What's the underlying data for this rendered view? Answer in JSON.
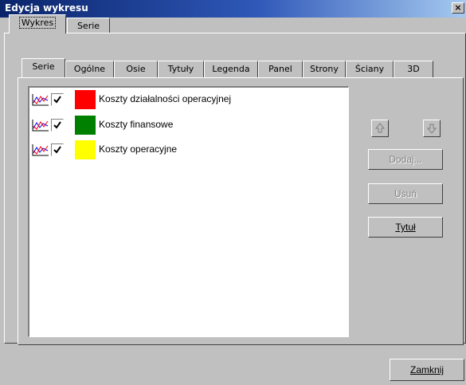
{
  "window": {
    "title": "Edycja wykresu",
    "close_glyph": "×"
  },
  "outer_tabs": [
    {
      "label": "Wykres",
      "active": true
    },
    {
      "label": "Serie",
      "active": false
    }
  ],
  "inner_tabs": [
    {
      "label": "Serie",
      "active": true
    },
    {
      "label": "Ogólne"
    },
    {
      "label": "Osie"
    },
    {
      "label": "Tytuły"
    },
    {
      "label": "Legenda"
    },
    {
      "label": "Panel"
    },
    {
      "label": "Strony"
    },
    {
      "label": "Ściany"
    },
    {
      "label": "3D"
    }
  ],
  "series": [
    {
      "name": "Koszty działalności operacyjnej",
      "color": "#ff0000",
      "checked": true,
      "icon": "line-chart-icon"
    },
    {
      "name": "Koszty finansowe",
      "color": "#008000",
      "checked": true,
      "icon": "line-chart-icon"
    },
    {
      "name": "Koszty operacyjne",
      "color": "#ffff00",
      "checked": true,
      "icon": "line-chart-icon"
    }
  ],
  "buttons": {
    "move_up_icon": "arrow-up-icon",
    "move_down_icon": "arrow-down-icon",
    "add": {
      "label": "Dodaj...",
      "enabled": false
    },
    "remove": {
      "label": "Usuń",
      "enabled": false
    },
    "title": {
      "label": "Tytuł",
      "enabled": true
    },
    "close": {
      "label": "Zamknij"
    }
  }
}
